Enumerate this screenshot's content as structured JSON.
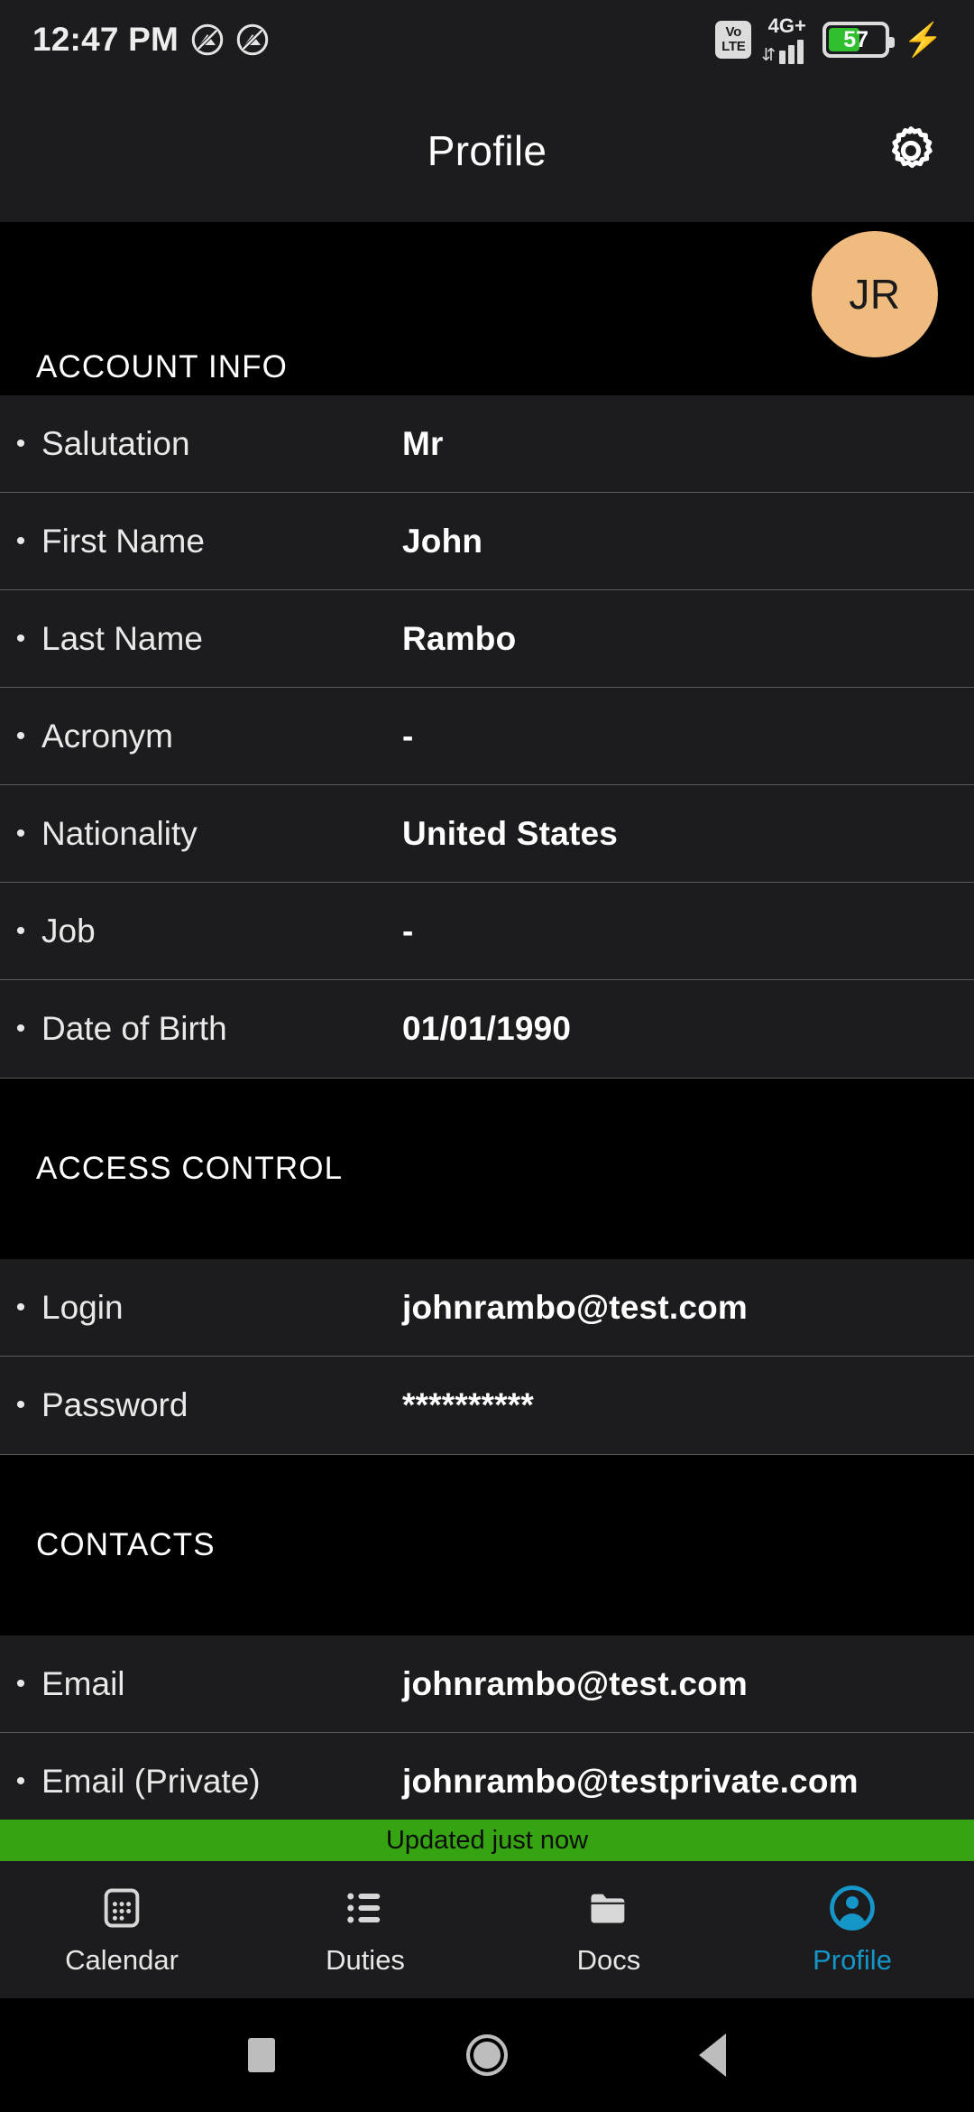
{
  "status_bar": {
    "time": "12:47 PM",
    "icons": [
      "mute-icon",
      "mute-icon"
    ],
    "volte_top": "Vo",
    "volte_bottom": "LTE",
    "network": "4G+",
    "data_arrows": "⇵",
    "battery_level": "57",
    "battery_percent": 57,
    "charging_icon": "lightning-bolt-icon"
  },
  "app_bar": {
    "title": "Profile",
    "settings_icon": "gear-icon"
  },
  "avatar": {
    "initials": "JR",
    "color": "#efbb7f"
  },
  "sections": [
    {
      "title": "ACCOUNT INFO",
      "rows": [
        {
          "label": "Salutation",
          "value": "Mr"
        },
        {
          "label": "First Name",
          "value": "John"
        },
        {
          "label": "Last Name",
          "value": "Rambo"
        },
        {
          "label": "Acronym",
          "value": "-"
        },
        {
          "label": "Nationality",
          "value": "United States"
        },
        {
          "label": "Job",
          "value": "-"
        },
        {
          "label": "Date of Birth",
          "value": "01/01/1990"
        }
      ]
    },
    {
      "title": "ACCESS CONTROL",
      "rows": [
        {
          "label": "Login",
          "value": "johnrambo@test.com"
        },
        {
          "label": "Password",
          "value": "**********"
        }
      ]
    },
    {
      "title": "CONTACTS",
      "rows": [
        {
          "label": "Email",
          "value": "johnrambo@test.com"
        },
        {
          "label": "Email (Private)",
          "value": "johnrambo@testprivate.com"
        }
      ]
    }
  ],
  "bullet": "•",
  "toast": {
    "message": "Updated just now",
    "background": "#36a312"
  },
  "bottom_nav": {
    "active_color": "#1496c8",
    "items": [
      {
        "label": "Calendar",
        "icon": "calendar-icon",
        "active": false
      },
      {
        "label": "Duties",
        "icon": "list-icon",
        "active": false
      },
      {
        "label": "Docs",
        "icon": "folder-icon",
        "active": false
      },
      {
        "label": "Profile",
        "icon": "person-circle-icon",
        "active": true
      }
    ]
  },
  "system_nav": {
    "recents_icon": "square-icon",
    "home_icon": "circle-icon",
    "back_icon": "triangle-back-icon"
  }
}
